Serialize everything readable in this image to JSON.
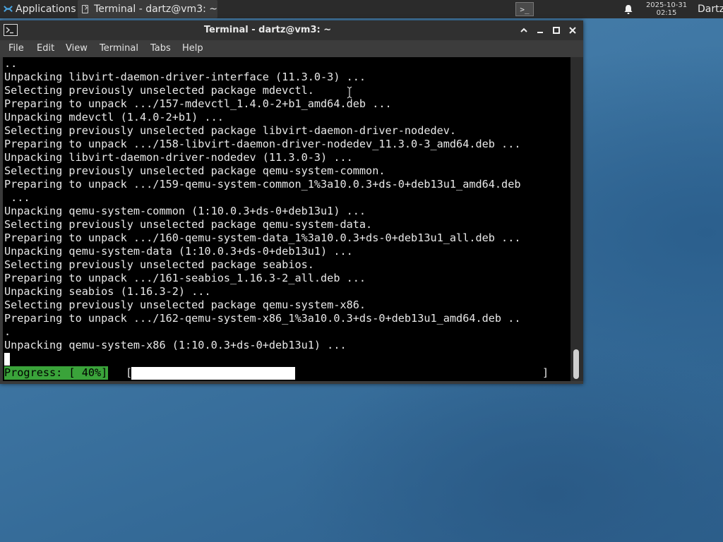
{
  "panel": {
    "apps_label": "Applications",
    "task_title": "Terminal - dartz@vm3: ~",
    "workspace_icon": ">_",
    "date": "2025-10-31",
    "time": "02:15",
    "user": "Dartz"
  },
  "window": {
    "title": "Terminal - dartz@vm3: ~",
    "controls": [
      "up-arrow-icon",
      "minimize-icon",
      "maximize-icon",
      "close-icon"
    ]
  },
  "menu": {
    "items": [
      "File",
      "Edit",
      "View",
      "Terminal",
      "Tabs",
      "Help"
    ]
  },
  "terminal": {
    "lines": [
      "..",
      "Unpacking libvirt-daemon-driver-interface (11.3.0-3) ...",
      "Selecting previously unselected package mdevctl.",
      "Preparing to unpack .../157-mdevctl_1.4.0-2+b1_amd64.deb ...",
      "Unpacking mdevctl (1.4.0-2+b1) ...",
      "Selecting previously unselected package libvirt-daemon-driver-nodedev.",
      "Preparing to unpack .../158-libvirt-daemon-driver-nodedev_11.3.0-3_amd64.deb ...",
      "Unpacking libvirt-daemon-driver-nodedev (11.3.0-3) ...",
      "Selecting previously unselected package qemu-system-common.",
      "Preparing to unpack .../159-qemu-system-common_1%3a10.0.3+ds-0+deb13u1_amd64.deb",
      " ...",
      "Unpacking qemu-system-common (1:10.0.3+ds-0+deb13u1) ...",
      "Selecting previously unselected package qemu-system-data.",
      "Preparing to unpack .../160-qemu-system-data_1%3a10.0.3+ds-0+deb13u1_all.deb ...",
      "Unpacking qemu-system-data (1:10.0.3+ds-0+deb13u1) ...",
      "Selecting previously unselected package seabios.",
      "Preparing to unpack .../161-seabios_1.16.3-2_all.deb ...",
      "Unpacking seabios (1.16.3-2) ...",
      "Selecting previously unselected package qemu-system-x86.",
      "Preparing to unpack .../162-qemu-system-x86_1%3a10.0.3+ds-0+deb13u1_amd64.deb ..",
      ".",
      "Unpacking qemu-system-x86 (1:10.0.3+ds-0+deb13u1) ..."
    ],
    "progress_label": "Progress: [ 40%]",
    "progress_open": "[",
    "progress_close": "]",
    "progress_fraction": 0.4
  }
}
